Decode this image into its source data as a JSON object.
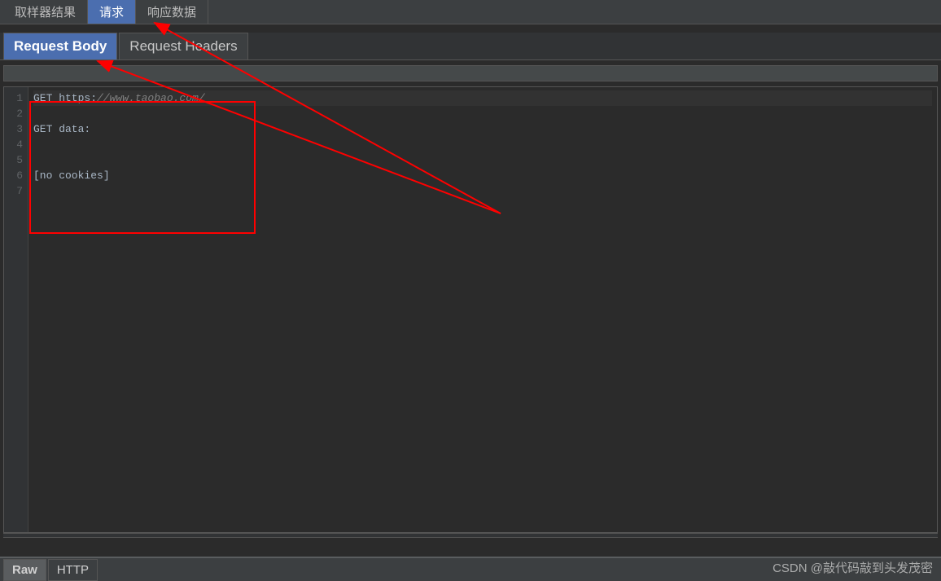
{
  "topTabs": {
    "sampler": "取样器结果",
    "request": "请求",
    "response": "响应数据"
  },
  "subTabs": {
    "body": "Request Body",
    "headers": "Request Headers"
  },
  "editor": {
    "lineNumbers": [
      "1",
      "2",
      "3",
      "4",
      "5",
      "6",
      "7"
    ],
    "line1_prefix": "GET https:",
    "line1_url": "//www.taobao.com/",
    "line3": "GET data:",
    "line6": "[no cookies]"
  },
  "bottomTabs": {
    "raw": "Raw",
    "http": "HTTP"
  },
  "watermark": "CSDN @敲代码敲到头发茂密"
}
